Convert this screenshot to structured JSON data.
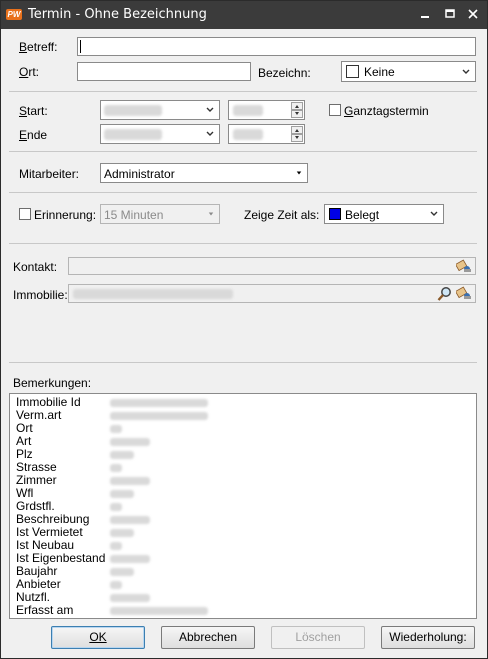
{
  "window": {
    "app_icon_text": "PW",
    "title": "Termin - Ohne Bezeichnung"
  },
  "form": {
    "betreff": {
      "label": "Betreff:",
      "value": ""
    },
    "ort": {
      "label": "Ort:",
      "value": ""
    },
    "bezeichn": {
      "label": "Bezeichn:",
      "value": "Keine"
    },
    "start": {
      "label": "Start:"
    },
    "ende": {
      "label": "Ende"
    },
    "ganztag": {
      "label": "Ganztagstermin",
      "checked": false
    },
    "mitarbeiter": {
      "label": "Mitarbeiter:",
      "value": "Administrator"
    },
    "erinnerung": {
      "label": "Erinnerung:",
      "value": "15 Minuten",
      "checked": false
    },
    "zeige_zeit": {
      "label": "Zeige Zeit als:",
      "value": "Belegt",
      "color": "#0000e6"
    },
    "kontakt": {
      "label": "Kontakt:"
    },
    "immobilie": {
      "label": "Immobilie:"
    },
    "bemerkungen": {
      "label": "Bemerkungen:",
      "lines": [
        "Immobilie Id",
        "Verm.art",
        "Ort",
        "Art",
        "Plz",
        "Strasse",
        "Zimmer",
        "Wfl",
        "Grdstfl.",
        "Beschreibung",
        "Ist Vermietet",
        "Ist Neubau",
        "Ist Eigenbestand",
        "Baujahr",
        "Anbieter",
        "Nutzfl.",
        "Erfasst am"
      ]
    }
  },
  "buttons": {
    "ok": "OK",
    "abbrechen": "Abbrechen",
    "loeschen": "Löschen",
    "wiederholung": "Wiederholung:"
  }
}
